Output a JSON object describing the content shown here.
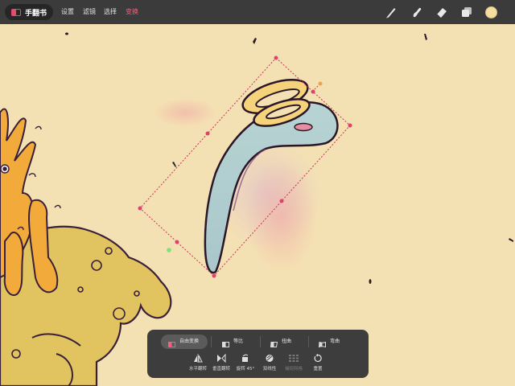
{
  "app": {
    "name": "手翻书",
    "brand_color": "#e64b6b"
  },
  "menu": {
    "items": [
      "设置",
      "滤镜",
      "选择",
      "变换"
    ],
    "active_index": 3,
    "active_color": "#ff5a7a"
  },
  "toolbar": {
    "tools": [
      "brush-icon",
      "smudge-icon",
      "eraser-icon",
      "layers-icon"
    ],
    "color_swatch": "#f6dea0"
  },
  "transform_panel": {
    "modes": [
      {
        "label": "自由变换",
        "icon": "free-transform-icon",
        "selected": true
      },
      {
        "label": "等比",
        "icon": "uniform-icon",
        "selected": false
      },
      {
        "label": "扭曲",
        "icon": "distort-icon",
        "selected": false
      },
      {
        "label": "弯曲",
        "icon": "warp-icon",
        "selected": false
      }
    ],
    "actions": [
      {
        "label": "水平翻转",
        "icon": "flip-horizontal-icon",
        "enabled": true
      },
      {
        "label": "垂直翻转",
        "icon": "flip-vertical-icon",
        "enabled": true
      },
      {
        "label": "旋转 45°",
        "icon": "rotate-45-icon",
        "enabled": true
      },
      {
        "label": "双线性",
        "icon": "interpolation-icon",
        "enabled": true
      },
      {
        "label": "捕捉网格",
        "icon": "grid-snap-icon",
        "enabled": false
      },
      {
        "label": "重置",
        "icon": "reset-icon",
        "enabled": true
      }
    ]
  }
}
